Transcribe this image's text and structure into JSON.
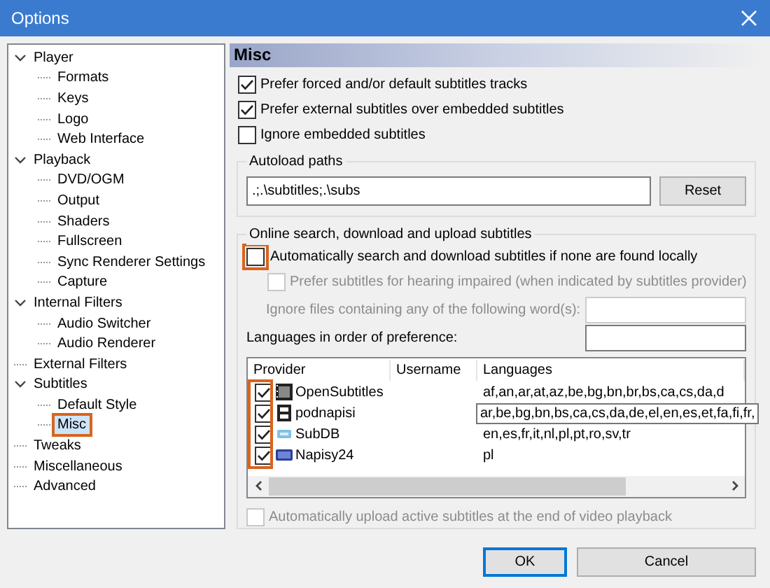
{
  "window": {
    "title": "Options"
  },
  "tree": [
    {
      "label": "Player",
      "expanded": true,
      "selected": false,
      "highlighted": false,
      "children": [
        {
          "label": "Formats",
          "selected": false,
          "highlighted": false
        },
        {
          "label": "Keys",
          "selected": false,
          "highlighted": false
        },
        {
          "label": "Logo",
          "selected": false,
          "highlighted": false
        },
        {
          "label": "Web Interface",
          "selected": false,
          "highlighted": false
        }
      ]
    },
    {
      "label": "Playback",
      "expanded": true,
      "selected": false,
      "highlighted": false,
      "children": [
        {
          "label": "DVD/OGM",
          "selected": false,
          "highlighted": false
        },
        {
          "label": "Output",
          "selected": false,
          "highlighted": false
        },
        {
          "label": "Shaders",
          "selected": false,
          "highlighted": false
        },
        {
          "label": "Fullscreen",
          "selected": false,
          "highlighted": false
        },
        {
          "label": "Sync Renderer Settings",
          "selected": false,
          "highlighted": false
        },
        {
          "label": "Capture",
          "selected": false,
          "highlighted": false
        }
      ]
    },
    {
      "label": "Internal Filters",
      "expanded": true,
      "selected": false,
      "highlighted": false,
      "children": [
        {
          "label": "Audio Switcher",
          "selected": false,
          "highlighted": false
        },
        {
          "label": "Audio Renderer",
          "selected": false,
          "highlighted": false
        }
      ]
    },
    {
      "label": "External Filters",
      "selected": false,
      "highlighted": false
    },
    {
      "label": "Subtitles",
      "expanded": true,
      "selected": false,
      "highlighted": false,
      "children": [
        {
          "label": "Default Style",
          "selected": false,
          "highlighted": false
        },
        {
          "label": "Misc",
          "selected": true,
          "highlighted": true
        }
      ]
    },
    {
      "label": "Tweaks",
      "selected": false,
      "highlighted": false
    },
    {
      "label": "Miscellaneous",
      "selected": false,
      "highlighted": false
    },
    {
      "label": "Advanced",
      "selected": false,
      "highlighted": false
    }
  ],
  "page": {
    "title": "Misc",
    "options": [
      {
        "label": "Prefer forced and/or default subtitles tracks",
        "checked": true
      },
      {
        "label": "Prefer external subtitles over embedded subtitles",
        "checked": true
      },
      {
        "label": "Ignore embedded subtitles",
        "checked": false
      }
    ],
    "autoload": {
      "title": "Autoload paths",
      "value": ".;.\\subtitles;.\\subs",
      "button": "Reset"
    },
    "online": {
      "title": "Online search, download and upload subtitles",
      "auto_search": {
        "label": "Automatically search and download subtitles if none are found locally",
        "checked": false,
        "highlighted": true
      },
      "hearing_impaired": {
        "label": "Prefer subtitles for hearing impaired (when indicated by subtitles provider)",
        "checked": false,
        "disabled": true
      },
      "ignore_words": {
        "label": "Ignore files containing any of the following word(s):",
        "disabled": true
      },
      "languages": {
        "label": "Languages in order of preference:"
      },
      "table": {
        "columns": [
          "Provider",
          "Username",
          "Languages"
        ],
        "checkboxes_highlighted": true,
        "rows": [
          {
            "checked": true,
            "kind": "film",
            "provider": "OpenSubtitles",
            "languages": "af,an,ar,at,az,be,bg,bn,br,bs,ca,cs,da,d"
          },
          {
            "checked": true,
            "kind": "document",
            "provider": "podnapisi",
            "languages": ""
          },
          {
            "checked": true,
            "kind": "chip",
            "provider": "SubDB",
            "languages": "en,es,fr,it,nl,pl,pt,ro,sv,tr"
          },
          {
            "checked": true,
            "kind": "monitor",
            "provider": "Napisy24",
            "languages": "pl"
          }
        ],
        "tooltip": "ar,be,bg,bn,bs,ca,cs,da,de,el,en,es,et,fa,fi,fr,"
      },
      "auto_upload": {
        "label": "Automatically upload active subtitles at the end of video playback",
        "checked": false,
        "disabled": true
      }
    }
  },
  "buttons": [
    {
      "label": "OK",
      "default": true
    },
    {
      "label": "Cancel",
      "default": false
    }
  ]
}
